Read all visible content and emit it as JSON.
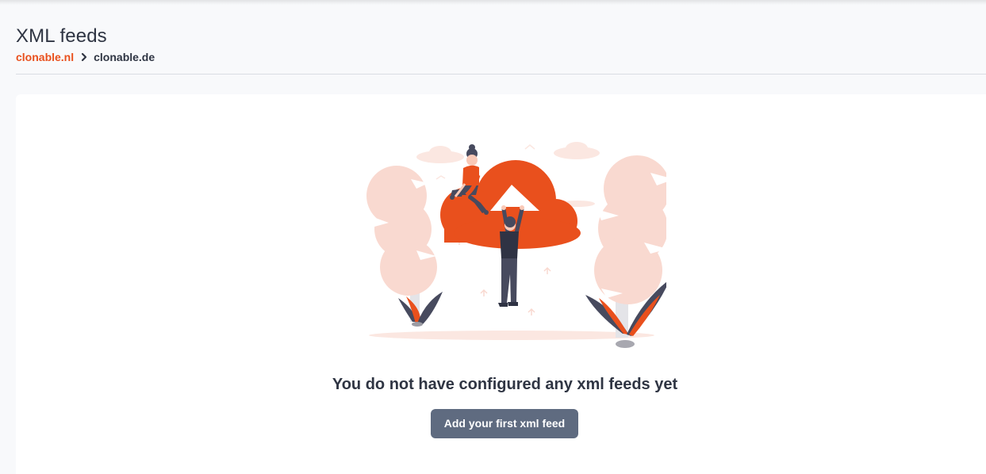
{
  "page": {
    "title": "XML feeds"
  },
  "breadcrumb": {
    "parent": "clonable.nl",
    "current": "clonable.de",
    "separator_icon": "chevron-right-icon"
  },
  "empty_state": {
    "illustration": "cloud-upload-people-illustration",
    "message": "You do not have configured any xml feeds yet",
    "button_label": "Add your first xml feed"
  },
  "colors": {
    "accent": "#e9501d",
    "button": "#5f6b80",
    "text": "#2f3543",
    "background": "#f8f9fb",
    "card": "#ffffff",
    "tree": "#f9d9d0"
  }
}
